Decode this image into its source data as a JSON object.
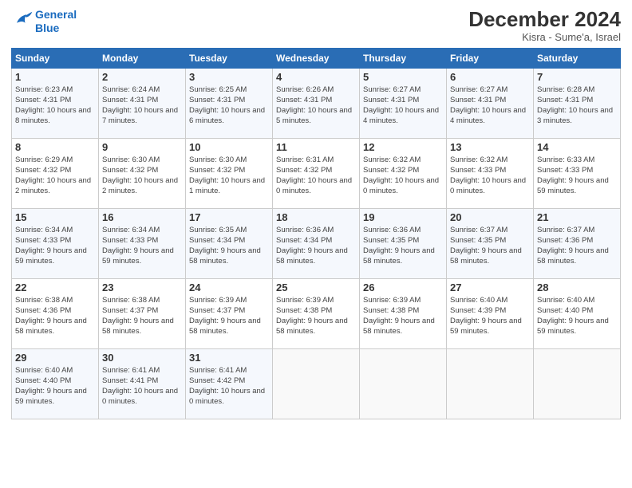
{
  "logo": {
    "line1": "General",
    "line2": "Blue"
  },
  "title": "December 2024",
  "location": "Kisra - Sume'a, Israel",
  "days_of_week": [
    "Sunday",
    "Monday",
    "Tuesday",
    "Wednesday",
    "Thursday",
    "Friday",
    "Saturday"
  ],
  "weeks": [
    [
      {
        "day": "1",
        "sunrise": "6:23 AM",
        "sunset": "4:31 PM",
        "daylight": "10 hours and 8 minutes."
      },
      {
        "day": "2",
        "sunrise": "6:24 AM",
        "sunset": "4:31 PM",
        "daylight": "10 hours and 7 minutes."
      },
      {
        "day": "3",
        "sunrise": "6:25 AM",
        "sunset": "4:31 PM",
        "daylight": "10 hours and 6 minutes."
      },
      {
        "day": "4",
        "sunrise": "6:26 AM",
        "sunset": "4:31 PM",
        "daylight": "10 hours and 5 minutes."
      },
      {
        "day": "5",
        "sunrise": "6:27 AM",
        "sunset": "4:31 PM",
        "daylight": "10 hours and 4 minutes."
      },
      {
        "day": "6",
        "sunrise": "6:27 AM",
        "sunset": "4:31 PM",
        "daylight": "10 hours and 4 minutes."
      },
      {
        "day": "7",
        "sunrise": "6:28 AM",
        "sunset": "4:31 PM",
        "daylight": "10 hours and 3 minutes."
      }
    ],
    [
      {
        "day": "8",
        "sunrise": "6:29 AM",
        "sunset": "4:32 PM",
        "daylight": "10 hours and 2 minutes."
      },
      {
        "day": "9",
        "sunrise": "6:30 AM",
        "sunset": "4:32 PM",
        "daylight": "10 hours and 2 minutes."
      },
      {
        "day": "10",
        "sunrise": "6:30 AM",
        "sunset": "4:32 PM",
        "daylight": "10 hours and 1 minute."
      },
      {
        "day": "11",
        "sunrise": "6:31 AM",
        "sunset": "4:32 PM",
        "daylight": "10 hours and 0 minutes."
      },
      {
        "day": "12",
        "sunrise": "6:32 AM",
        "sunset": "4:32 PM",
        "daylight": "10 hours and 0 minutes."
      },
      {
        "day": "13",
        "sunrise": "6:32 AM",
        "sunset": "4:33 PM",
        "daylight": "10 hours and 0 minutes."
      },
      {
        "day": "14",
        "sunrise": "6:33 AM",
        "sunset": "4:33 PM",
        "daylight": "9 hours and 59 minutes."
      }
    ],
    [
      {
        "day": "15",
        "sunrise": "6:34 AM",
        "sunset": "4:33 PM",
        "daylight": "9 hours and 59 minutes."
      },
      {
        "day": "16",
        "sunrise": "6:34 AM",
        "sunset": "4:33 PM",
        "daylight": "9 hours and 59 minutes."
      },
      {
        "day": "17",
        "sunrise": "6:35 AM",
        "sunset": "4:34 PM",
        "daylight": "9 hours and 58 minutes."
      },
      {
        "day": "18",
        "sunrise": "6:36 AM",
        "sunset": "4:34 PM",
        "daylight": "9 hours and 58 minutes."
      },
      {
        "day": "19",
        "sunrise": "6:36 AM",
        "sunset": "4:35 PM",
        "daylight": "9 hours and 58 minutes."
      },
      {
        "day": "20",
        "sunrise": "6:37 AM",
        "sunset": "4:35 PM",
        "daylight": "9 hours and 58 minutes."
      },
      {
        "day": "21",
        "sunrise": "6:37 AM",
        "sunset": "4:36 PM",
        "daylight": "9 hours and 58 minutes."
      }
    ],
    [
      {
        "day": "22",
        "sunrise": "6:38 AM",
        "sunset": "4:36 PM",
        "daylight": "9 hours and 58 minutes."
      },
      {
        "day": "23",
        "sunrise": "6:38 AM",
        "sunset": "4:37 PM",
        "daylight": "9 hours and 58 minutes."
      },
      {
        "day": "24",
        "sunrise": "6:39 AM",
        "sunset": "4:37 PM",
        "daylight": "9 hours and 58 minutes."
      },
      {
        "day": "25",
        "sunrise": "6:39 AM",
        "sunset": "4:38 PM",
        "daylight": "9 hours and 58 minutes."
      },
      {
        "day": "26",
        "sunrise": "6:39 AM",
        "sunset": "4:38 PM",
        "daylight": "9 hours and 58 minutes."
      },
      {
        "day": "27",
        "sunrise": "6:40 AM",
        "sunset": "4:39 PM",
        "daylight": "9 hours and 59 minutes."
      },
      {
        "day": "28",
        "sunrise": "6:40 AM",
        "sunset": "4:40 PM",
        "daylight": "9 hours and 59 minutes."
      }
    ],
    [
      {
        "day": "29",
        "sunrise": "6:40 AM",
        "sunset": "4:40 PM",
        "daylight": "9 hours and 59 minutes."
      },
      {
        "day": "30",
        "sunrise": "6:41 AM",
        "sunset": "4:41 PM",
        "daylight": "10 hours and 0 minutes."
      },
      {
        "day": "31",
        "sunrise": "6:41 AM",
        "sunset": "4:42 PM",
        "daylight": "10 hours and 0 minutes."
      },
      null,
      null,
      null,
      null
    ]
  ]
}
